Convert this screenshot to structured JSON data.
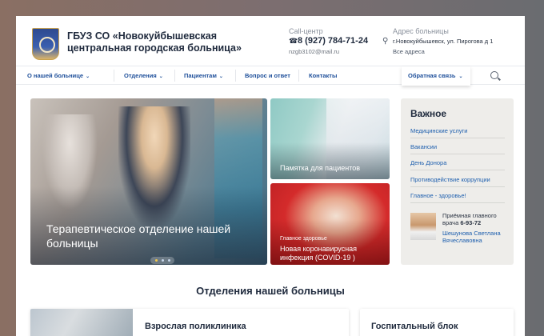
{
  "header": {
    "org_name": "ГБУЗ СО «Новокуйбышевская центральная городская больница»",
    "call_center_label": "Call-центр",
    "phone": "8 (927) 784-71-24",
    "email": "nzgb3102@mail.ru",
    "address_label": "Адрес больницы",
    "address": "г.Новокуйбышевск, ул. Пирогова д 1",
    "all_addresses": "Все адреса"
  },
  "nav": {
    "items": [
      {
        "label": "О нашей больнице",
        "dropdown": true
      },
      {
        "label": "Отделения",
        "dropdown": true
      },
      {
        "label": "Пациентам",
        "dropdown": true
      },
      {
        "label": "Вопрос и ответ",
        "dropdown": false
      },
      {
        "label": "Контакты",
        "dropdown": false
      }
    ],
    "feedback": "Обратная связь",
    "chevron": "⌄"
  },
  "hero": {
    "title": "Терапевтическое отделение нашей больницы",
    "slides": 3,
    "active_slide": 1
  },
  "tiles": {
    "memo": {
      "title": "Памятка для пациентов"
    },
    "covid": {
      "kicker": "Главное здоровье",
      "title": "Новая коронавирусная инфекция (COVID-19 )"
    }
  },
  "important": {
    "title": "Важное",
    "links": [
      "Медицинские услуги",
      "Вакансии",
      "День Донора",
      "Противодействие коррупции",
      "Главное - здоровье!"
    ],
    "chief_role": "Приёмная главного врача",
    "chief_phone": "6-93-72",
    "chief_name": "Шешунова Светлана Вячеславовна"
  },
  "departments": {
    "title": "Отделения нашей больницы",
    "cards": [
      "Взрослая поликлиника",
      "Госпитальный блок"
    ]
  },
  "colors": {
    "link": "#1e5fae",
    "nav": "#1e4f9a",
    "heading": "#1f2a3d",
    "accent_dot": "#f2c94c"
  }
}
